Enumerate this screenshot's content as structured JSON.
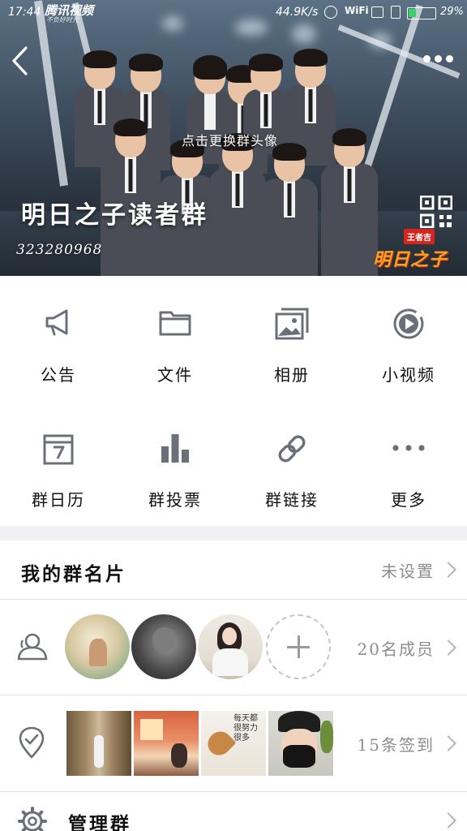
{
  "status_bar": {
    "time": "17:44",
    "app_name": "腾讯视频",
    "app_slogan": "不负好时光",
    "net_speed": "44.9K/s",
    "wifi_label": "WiFi",
    "battery_level": 0.29,
    "battery_text": "29%"
  },
  "header": {
    "change_avatar": "点击更换群头像",
    "group_name": "明日之子读者群",
    "group_number": "323280968",
    "show_logo_badge": "王者吉",
    "show_logo_text": "明日之子"
  },
  "features": [
    {
      "label": "公告",
      "icon": "megaphone-icon"
    },
    {
      "label": "文件",
      "icon": "folder-icon"
    },
    {
      "label": "相册",
      "icon": "photo-album-icon"
    },
    {
      "label": "小视频",
      "icon": "video-play-icon"
    },
    {
      "label": "群日历",
      "icon": "calendar-icon"
    },
    {
      "label": "群投票",
      "icon": "bar-chart-icon"
    },
    {
      "label": "群链接",
      "icon": "link-icon"
    },
    {
      "label": "更多",
      "icon": "more-dots-icon"
    }
  ],
  "card": {
    "title": "我的群名片",
    "value": "未设置"
  },
  "members": {
    "count_text": "20名成员"
  },
  "checkin": {
    "count_text": "15条签到",
    "thumb3_text": "每天都很努力很多"
  },
  "manage": {
    "title": "管理群"
  },
  "colors": {
    "icon_gray": "#6b7078",
    "battery_green": "#36d36a",
    "logo_red": "#d6241e",
    "logo_orange": "#f4a41f"
  }
}
